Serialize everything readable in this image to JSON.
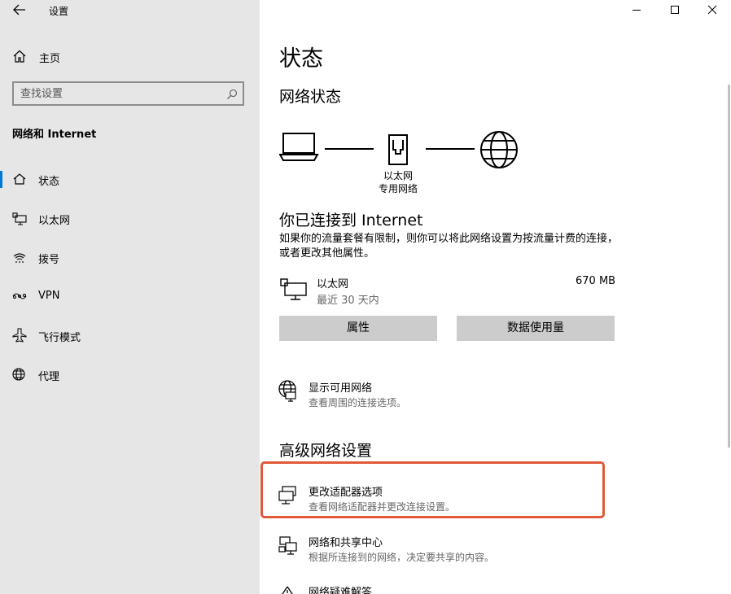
{
  "window": {
    "title": "设置"
  },
  "sidebar": {
    "home_label": "主页",
    "search_placeholder": "查找设置",
    "section_title": "网络和 Internet",
    "items": [
      {
        "label": "状态",
        "icon": "home-status-icon",
        "selected": true
      },
      {
        "label": "以太网",
        "icon": "ethernet-icon"
      },
      {
        "label": "拨号",
        "icon": "dialup-icon"
      },
      {
        "label": "VPN",
        "icon": "vpn-icon"
      },
      {
        "label": "飞行模式",
        "icon": "airplane-icon"
      },
      {
        "label": "代理",
        "icon": "globe-icon"
      }
    ]
  },
  "main": {
    "page_title": "状态",
    "network_status_heading": "网络状态",
    "diagram_label_line1": "以太网",
    "diagram_label_line2": "专用网络",
    "connected_heading": "你已连接到 Internet",
    "connected_desc": "如果你的流量套餐有限制，则你可以将此网络设置为按流量计费的连接，或者更改其他属性。",
    "adapter": {
      "name": "以太网",
      "period": "最近 30 天内",
      "usage": "670 MB"
    },
    "buttons": {
      "properties": "属性",
      "data_usage": "数据使用量"
    },
    "show_networks": {
      "title": "显示可用网络",
      "desc": "查看周围的连接选项。"
    },
    "advanced_heading": "高级网络设置",
    "links": [
      {
        "title": "更改适配器选项",
        "desc": "查看网络适配器并更改连接设置。"
      },
      {
        "title": "网络和共享中心",
        "desc": "根据所连接到的网络，决定要共享的内容。"
      },
      {
        "title": "网络疑难解答",
        "desc": ""
      }
    ]
  },
  "colors": {
    "accent": "#0078d7",
    "highlight": "#e05a3a",
    "sidebar_bg": "#e6e6e6"
  }
}
